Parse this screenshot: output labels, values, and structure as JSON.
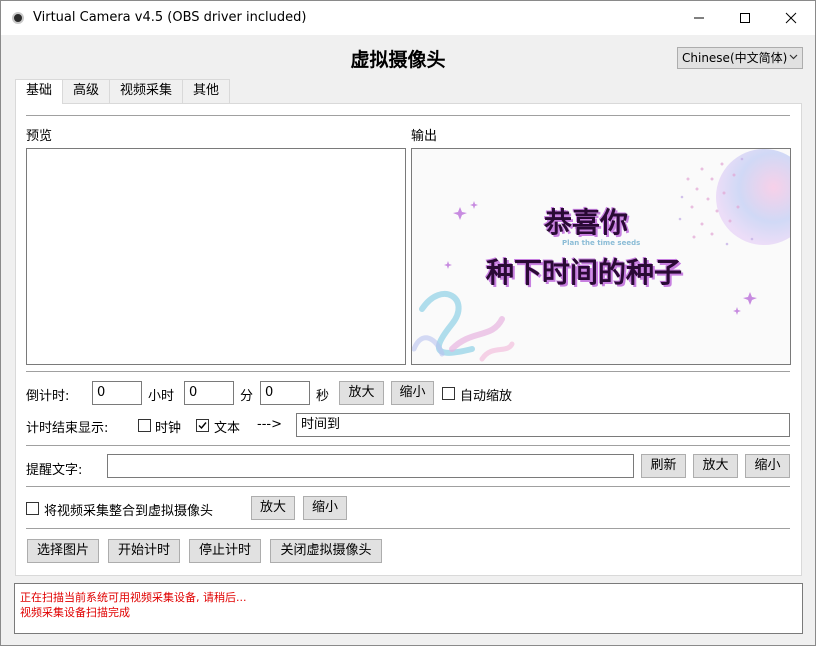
{
  "window": {
    "title": "Virtual Camera v4.5 (OBS driver included)"
  },
  "header": {
    "title": "虚拟摄像头",
    "language": "Chinese(中文简体)"
  },
  "tabs": [
    {
      "label": "基础",
      "active": true
    },
    {
      "label": "高级",
      "active": false
    },
    {
      "label": "视频采集",
      "active": false
    },
    {
      "label": "其他",
      "active": false
    }
  ],
  "basic": {
    "preview_label": "预览",
    "output_label": "输出",
    "output_image": {
      "line1": "恭喜你",
      "subtitle": "Plan the time seeds",
      "line2": "种下时间的种子"
    },
    "countdown": {
      "label": "倒计时:",
      "hours_value": "0",
      "hours_unit": "小时",
      "minutes_value": "0",
      "minutes_unit": "分",
      "seconds_value": "0",
      "seconds_unit": "秒",
      "zoom_in": "放大",
      "zoom_out": "缩小",
      "auto_scale": "自动缩放",
      "auto_scale_checked": false
    },
    "end_display": {
      "label": "计时结束显示:",
      "clock_label": "时钟",
      "clock_checked": false,
      "text_label": "文本",
      "text_checked": true,
      "arrow": "--->",
      "text_value": "时间到"
    },
    "reminder": {
      "label": "提醒文字:",
      "value": "",
      "refresh": "刷新",
      "zoom_in": "放大",
      "zoom_out": "缩小"
    },
    "integrate": {
      "label": "将视频采集整合到虚拟摄像头",
      "checked": false,
      "zoom_in": "放大",
      "zoom_out": "缩小"
    },
    "actions": {
      "select_image": "选择图片",
      "start_timer": "开始计时",
      "stop_timer": "停止计时",
      "close_camera": "关闭虚拟摄像头"
    }
  },
  "status": {
    "lines": [
      "正在扫描当前系统可用视频采集设备, 请稍后...",
      "视频采集设备扫描完成"
    ],
    "color": "#e00000"
  }
}
